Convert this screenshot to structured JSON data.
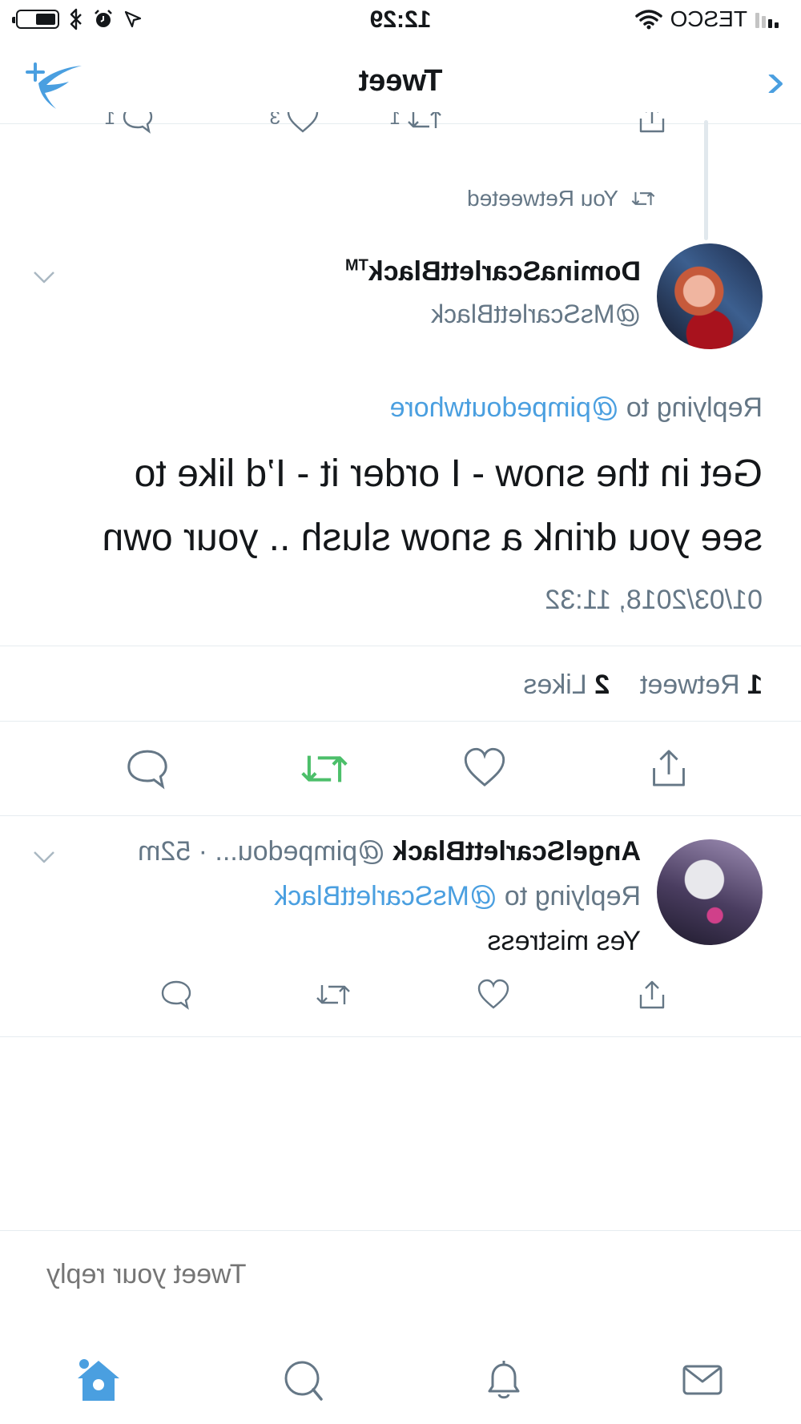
{
  "status_bar": {
    "carrier": "TESCO",
    "time": "12:29",
    "battery_level": 0.55,
    "icons": [
      "signal-icon",
      "wifi-icon",
      "location-icon",
      "alarm-icon",
      "bluetooth-icon",
      "battery-icon"
    ]
  },
  "nav": {
    "title": "Tweet",
    "back_icon": "chevron-left-icon",
    "compose_icon": "compose-tweet-icon"
  },
  "previous_tweet_actions": {
    "reply_count": "1",
    "retweet_count": "1",
    "like_count": "3"
  },
  "retweet_note": "You Retweeted",
  "tweet": {
    "author_name": "DominaScarlettBlack",
    "author_suffix": "TM",
    "author_handle": "@MsScarlettBlack",
    "replying_prefix": "Replying to",
    "replying_to": "@pimpedoutwhore",
    "text_line1": "Get in the snow - I order it - I’d like to",
    "text_line2": "see you drink a snow slush .. your own",
    "timestamp": "01/03/2018, 11:32",
    "retweet_count": "1",
    "retweet_label": "Retweet",
    "like_count": "2",
    "like_label": "Likes",
    "colors": {
      "retweeted": "#4cbf6a",
      "link": "#4a9fe0",
      "secondary": "#657786"
    }
  },
  "reply": {
    "author_name": "AngelScarlettBlack",
    "author_handle": "@pimpedou...",
    "age": "· 52m",
    "replying_prefix": "Replying to",
    "replying_to": "@MsScarlettBlack",
    "text": "Yes mistress"
  },
  "composer": {
    "placeholder": "Tweet your reply"
  },
  "tab_bar": {
    "items": [
      "home-icon",
      "explore-icon",
      "notifications-icon",
      "messages-icon"
    ],
    "active": "home-icon",
    "accent": "#4a9fe0"
  }
}
